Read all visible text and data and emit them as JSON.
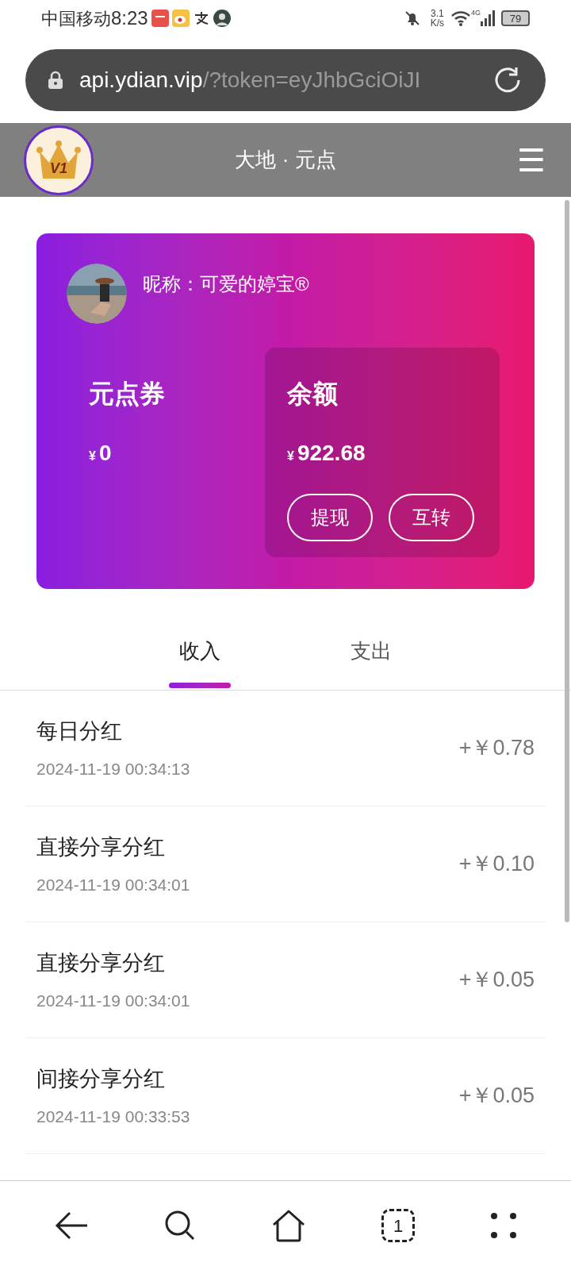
{
  "status_bar": {
    "carrier": "中国移动",
    "time": "8:23",
    "speed": "3.1",
    "speed_unit": "K/s",
    "network": "4G",
    "battery": "79"
  },
  "address_bar": {
    "host": "api.ydian.vip",
    "path": "/?token=eyJhbGciOiJI"
  },
  "header": {
    "badge": "V1",
    "title": "大地 · 元点",
    "menu": "☰"
  },
  "account": {
    "nickname": "昵称：可爱的婷宝®",
    "coupons": {
      "label": "元点券",
      "currency": "¥",
      "amount": "0"
    },
    "balance": {
      "label": "余额",
      "currency": "¥",
      "amount": "922.68",
      "actions": [
        "提现",
        "互转"
      ]
    }
  },
  "tabs": [
    {
      "label": "收入",
      "selected": true
    },
    {
      "label": "支出",
      "selected": false
    }
  ],
  "records": [
    {
      "title": "每日分红",
      "time": "2024-11-19 00:34:13",
      "amount": "+￥0.78"
    },
    {
      "title": "直接分享分红",
      "time": "2024-11-19 00:34:01",
      "amount": "+￥0.10"
    },
    {
      "title": "直接分享分红",
      "time": "2024-11-19 00:34:01",
      "amount": "+￥0.05"
    },
    {
      "title": "间接分享分红",
      "time": "2024-11-19 00:33:53",
      "amount": "+￥0.05"
    }
  ],
  "nav_bar": {
    "tab_count": "1"
  }
}
